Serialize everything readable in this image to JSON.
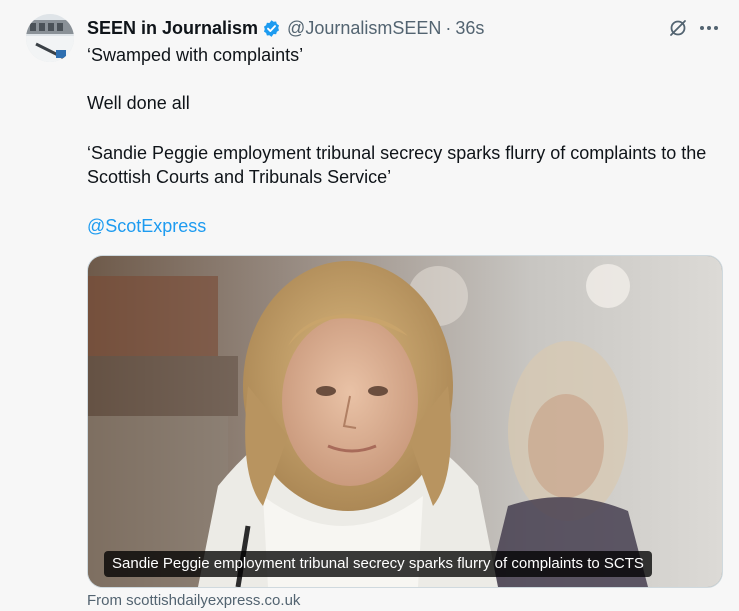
{
  "tweet": {
    "display_name": "SEEN in Journalism",
    "handle": "@JournalismSEEN",
    "separator": "·",
    "time": "36s",
    "lines": [
      "‘Swamped with complaints’",
      "Well done all",
      "‘Sandie Peggie employment tribunal secrecy sparks flurry of complaints to the Scottish Courts and Tribunals Service’"
    ],
    "mention": "@ScotExpress",
    "card": {
      "caption": "Sandie Peggie employment tribunal secrecy sparks flurry of complaints to SCTS",
      "source": "From scottishdailyexpress.co.uk"
    }
  },
  "icons": {
    "verified": "verified-badge-icon",
    "grok": "grok-icon",
    "more": "more-options-icon"
  },
  "colors": {
    "verified_blue": "#1d9bf0",
    "link": "#1d9bf0",
    "secondary_text": "#536471"
  }
}
